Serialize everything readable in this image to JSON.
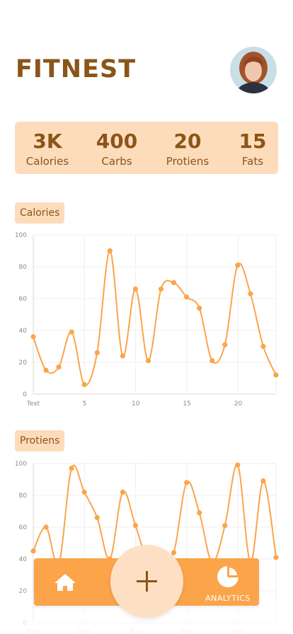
{
  "app": {
    "title": "FITNEST"
  },
  "stats": [
    {
      "value": "3K",
      "label": "Calories"
    },
    {
      "value": "400",
      "label": "Carbs"
    },
    {
      "value": "20",
      "label": "Protiens"
    },
    {
      "value": "15",
      "label": "Fats"
    }
  ],
  "charts": {
    "calories": {
      "tag": "Calories"
    },
    "protiens": {
      "tag": "Protiens"
    }
  },
  "nav": {
    "analytics_label": "ANALYTICS"
  },
  "colors": {
    "accent": "#fba44a",
    "brown": "#8b5419",
    "peach": "#fddcbb"
  },
  "chart_data": [
    {
      "type": "line",
      "title": "Calories",
      "xlabel": "",
      "ylabel": "",
      "x": [
        0,
        1,
        2,
        3,
        4,
        5,
        6,
        7,
        8,
        9,
        10,
        11,
        12,
        13,
        14,
        15,
        16,
        17,
        18,
        19,
        20,
        21,
        22,
        23
      ],
      "values": [
        36,
        15,
        17,
        39,
        6,
        26,
        90,
        24,
        66,
        21,
        66,
        70,
        61,
        54,
        21,
        31,
        81,
        63,
        30,
        12
      ],
      "x_points": [
        0,
        1,
        2,
        3,
        4,
        5,
        6,
        7,
        8,
        9,
        10,
        11,
        12,
        13,
        14,
        15,
        16,
        17,
        18,
        19
      ],
      "ylim": [
        0,
        100
      ],
      "y_ticks": [
        "0",
        "20",
        "40",
        "60",
        "80",
        "100"
      ],
      "x_tick_labels": [
        "Text",
        "5",
        "10",
        "15",
        "20"
      ],
      "grid": true
    },
    {
      "type": "line",
      "title": "Protiens",
      "xlabel": "",
      "ylabel": "",
      "values": [
        45,
        60,
        37,
        97,
        82,
        66,
        40,
        82,
        61,
        38,
        38,
        44,
        88,
        69,
        38,
        61,
        99,
        38,
        89,
        41
      ],
      "x_points": [
        0,
        1,
        2,
        3,
        4,
        5,
        6,
        7,
        8,
        9,
        10,
        11,
        12,
        13,
        14,
        15,
        16,
        17,
        18,
        19
      ],
      "ylim": [
        0,
        100
      ],
      "y_ticks": [
        "0",
        "20",
        "40",
        "60",
        "80",
        "100"
      ],
      "x_tick_labels": [
        "Text",
        "Text",
        "Text",
        "Text",
        "Text"
      ],
      "grid": true
    }
  ]
}
